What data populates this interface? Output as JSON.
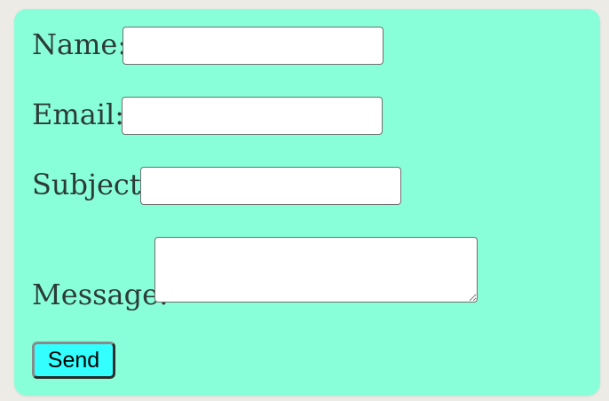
{
  "form": {
    "name_label": "Name:",
    "name_value": "",
    "email_label": "Email:",
    "email_value": "",
    "subject_label": "Subject:",
    "subject_value": "",
    "message_label": "Message:",
    "message_value": "",
    "send_label": "Send"
  },
  "colors": {
    "background": "#88ffd8",
    "button": "#33ffff",
    "label_text": "#2d3b38"
  }
}
